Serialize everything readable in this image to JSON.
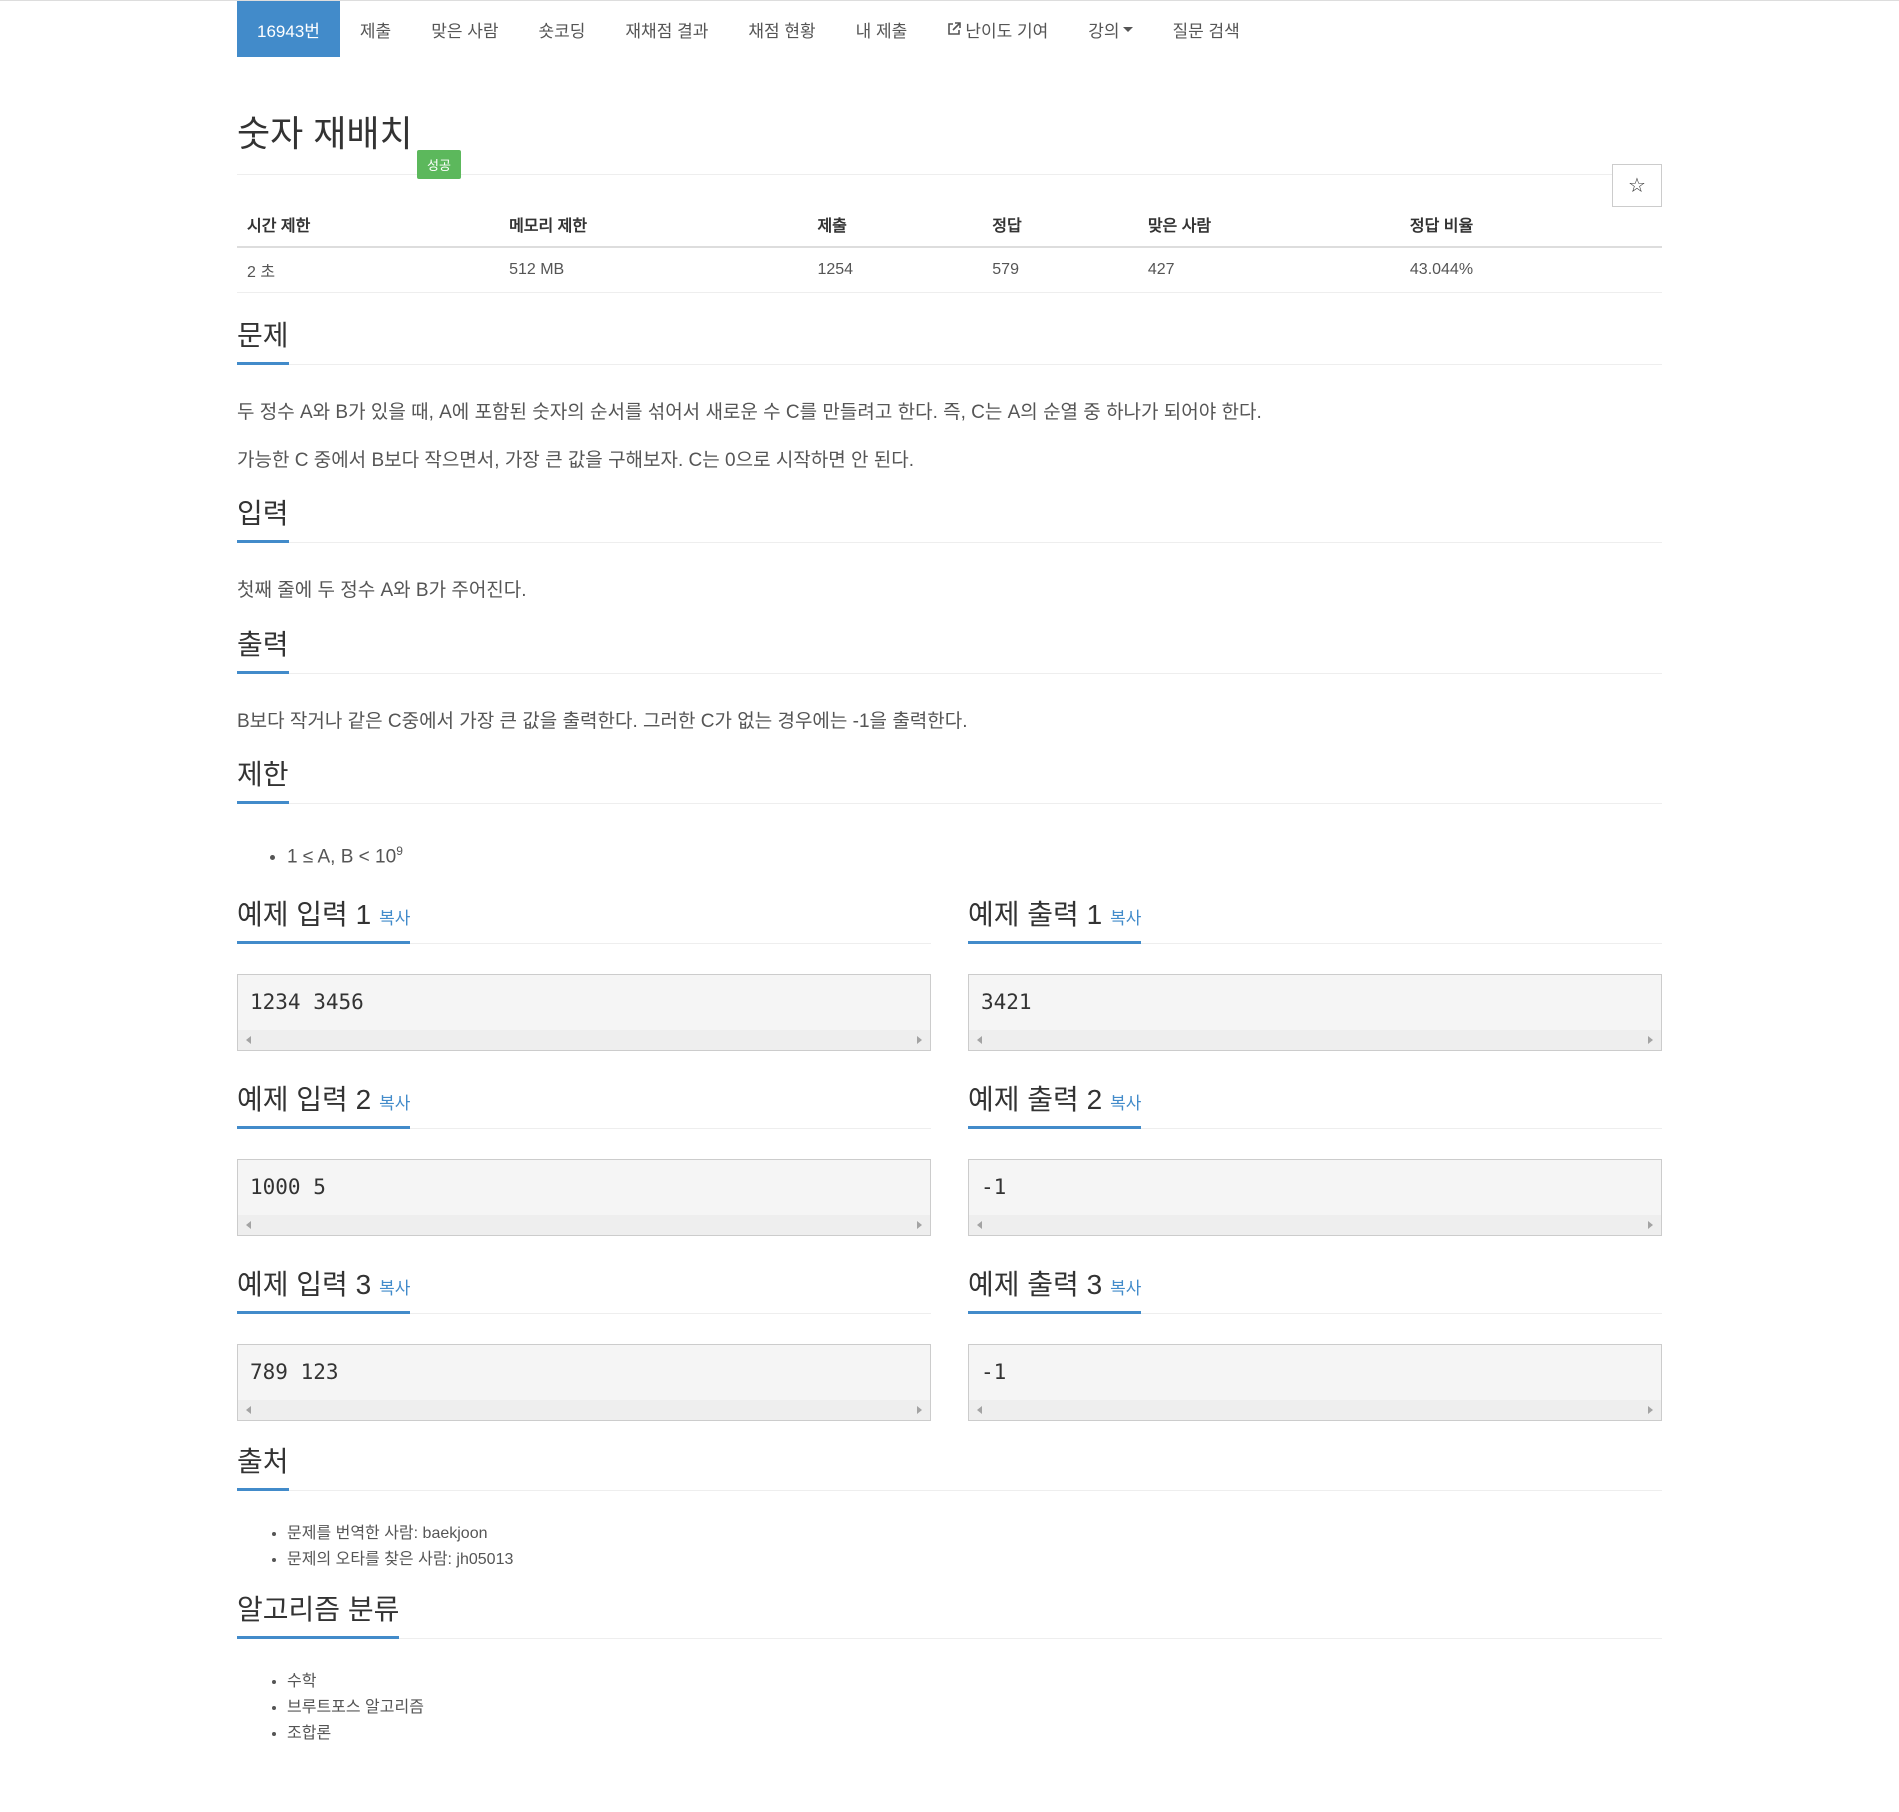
{
  "nav": {
    "items": [
      {
        "label": "16943번",
        "active": true
      },
      {
        "label": "제출"
      },
      {
        "label": "맞은 사람"
      },
      {
        "label": "숏코딩"
      },
      {
        "label": "재채점 결과"
      },
      {
        "label": "채점 현황"
      },
      {
        "label": "내 제출"
      },
      {
        "label": "난이도 기여",
        "icon": "external-link-icon"
      },
      {
        "label": "강의",
        "dropdown": true
      },
      {
        "label": "질문 검색"
      }
    ]
  },
  "problem": {
    "title": "숫자 재배치",
    "status_badge": "성공",
    "star": "☆"
  },
  "info": {
    "headers": [
      "시간 제한",
      "메모리 제한",
      "제출",
      "정답",
      "맞은 사람",
      "정답 비율"
    ],
    "values": [
      "2 초",
      "512 MB",
      "1254",
      "579",
      "427",
      "43.044%"
    ]
  },
  "sections": {
    "description": {
      "title": "문제",
      "paragraphs": [
        "두 정수 A와 B가 있을 때, A에 포함된 숫자의 순서를 섞어서 새로운 수 C를 만들려고 한다. 즉, C는 A의 순열 중 하나가 되어야 한다.",
        "가능한 C 중에서 B보다 작으면서, 가장 큰 값을 구해보자. C는 0으로 시작하면 안 된다."
      ]
    },
    "input": {
      "title": "입력",
      "text": "첫째 줄에 두 정수 A와 B가 주어진다."
    },
    "output": {
      "title": "출력",
      "text": "B보다 작거나 같은 C중에서 가장 큰 값을 출력한다. 그러한 C가 없는 경우에는 -1을 출력한다."
    },
    "limits": {
      "title": "제한",
      "item_text": "1 ≤ A, B < 10",
      "item_sup": "9"
    },
    "source": {
      "title": "출처",
      "items": [
        "문제를 번역한 사람: baekjoon",
        "문제의 오타를 찾은 사람: jh05013"
      ]
    },
    "algorithms": {
      "title": "알고리즘 분류",
      "items": [
        "수학",
        "브루트포스 알고리즘",
        "조합론"
      ]
    }
  },
  "samples": {
    "copy_label": "복사",
    "rows": [
      {
        "in_title": "예제 입력 1",
        "in_value": "1234 3456",
        "out_title": "예제 출력 1",
        "out_value": "3421"
      },
      {
        "in_title": "예제 입력 2",
        "in_value": "1000 5",
        "out_title": "예제 출력 2",
        "out_value": "-1"
      },
      {
        "in_title": "예제 입력 3",
        "in_value": "789 123",
        "out_title": "예제 출력 3",
        "out_value": "-1"
      }
    ]
  }
}
